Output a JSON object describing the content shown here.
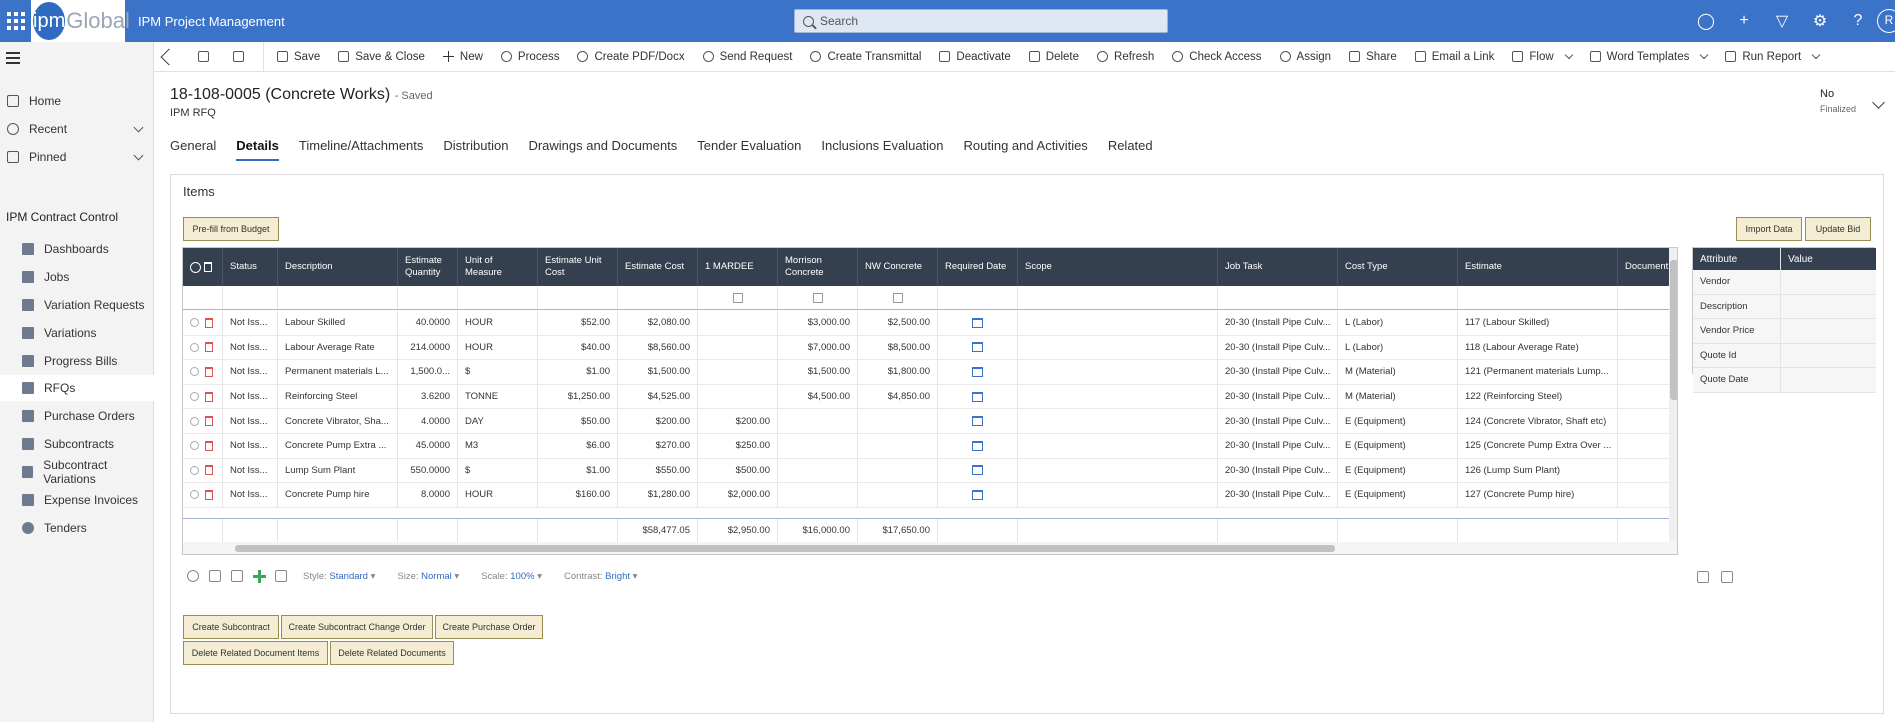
{
  "app": {
    "logo_mark": "ipm",
    "logo_text": "Global",
    "title": "IPM Project Management",
    "search_placeholder": "Search",
    "avatar_initial": "R"
  },
  "sidebar": {
    "home": "Home",
    "recent": "Recent",
    "pinned": "Pinned",
    "section": "IPM Contract Control",
    "items": [
      {
        "label": "Dashboards",
        "icon": "dashboard-icon"
      },
      {
        "label": "Jobs",
        "icon": "jobs-icon"
      },
      {
        "label": "Variation Requests",
        "icon": "document-icon"
      },
      {
        "label": "Variations",
        "icon": "document-icon"
      },
      {
        "label": "Progress Bills",
        "icon": "bill-icon"
      },
      {
        "label": "RFQs",
        "icon": "document-icon"
      },
      {
        "label": "Purchase Orders",
        "icon": "document-icon"
      },
      {
        "label": "Subcontracts",
        "icon": "document-icon"
      },
      {
        "label": "Subcontract Variations",
        "icon": "document-icon"
      },
      {
        "label": "Expense Invoices",
        "icon": "document-icon"
      },
      {
        "label": "Tenders",
        "icon": "tender-icon"
      }
    ]
  },
  "commands": {
    "save": "Save",
    "save_close": "Save & Close",
    "new": "New",
    "process": "Process",
    "create_pdf": "Create PDF/Docx",
    "send_request": "Send Request",
    "create_transmittal": "Create Transmittal",
    "deactivate": "Deactivate",
    "delete": "Delete",
    "refresh": "Refresh",
    "check_access": "Check Access",
    "assign": "Assign",
    "share": "Share",
    "email_link": "Email a Link",
    "flow": "Flow",
    "word_templates": "Word Templates",
    "run_report": "Run Report"
  },
  "record": {
    "title": "18-108-0005 (Concrete Works)",
    "saved": "- Saved",
    "entity": "IPM RFQ",
    "finalized_value": "No",
    "finalized_label": "Finalized"
  },
  "tabs": [
    "General",
    "Details",
    "Timeline/Attachments",
    "Distribution",
    "Drawings and Documents",
    "Tender Evaluation",
    "Inclusions Evaluation",
    "Routing and Activities",
    "Related"
  ],
  "items": {
    "title": "Items",
    "prefill_button": "Pre-fill from Budget",
    "import_button": "Import Data",
    "update_button": "Update Bid",
    "columns": [
      "Status",
      "Description",
      "Estimate Quantity",
      "Unit of Measure",
      "Estimate Unit Cost",
      "Estimate Cost",
      "1 MARDEE",
      "Morrison Concrete",
      "NW Concrete",
      "Required Date",
      "Scope",
      "Job Task",
      "Cost Type",
      "Estimate",
      "Document"
    ],
    "rows": [
      {
        "status": "Not Iss...",
        "description": "Labour Skilled",
        "qty": "40.0000",
        "uom": "HOUR",
        "unit_cost": "$52.00",
        "est_cost": "$2,080.00",
        "mardee": "",
        "morrison": "$3,000.00",
        "nw": "$2,500.00",
        "job_task": "20-30 (Install Pipe Culv...",
        "cost_type": "L (Labor)",
        "estimate": "117 (Labour Skilled)"
      },
      {
        "status": "Not Iss...",
        "description": "Labour Average Rate",
        "qty": "214.0000",
        "uom": "HOUR",
        "unit_cost": "$40.00",
        "est_cost": "$8,560.00",
        "mardee": "",
        "morrison": "$7,000.00",
        "nw": "$8,500.00",
        "job_task": "20-30 (Install Pipe Culv...",
        "cost_type": "L (Labor)",
        "estimate": "118 (Labour Average Rate)"
      },
      {
        "status": "Not Iss...",
        "description": "Permanent materials L...",
        "qty": "1,500.0...",
        "uom": "$",
        "unit_cost": "$1.00",
        "est_cost": "$1,500.00",
        "mardee": "",
        "morrison": "$1,500.00",
        "nw": "$1,800.00",
        "job_task": "20-30 (Install Pipe Culv...",
        "cost_type": "M (Material)",
        "estimate": "121 (Permanent materials Lump..."
      },
      {
        "status": "Not Iss...",
        "description": "Reinforcing Steel",
        "qty": "3.6200",
        "uom": "TONNE",
        "unit_cost": "$1,250.00",
        "est_cost": "$4,525.00",
        "mardee": "",
        "morrison": "$4,500.00",
        "nw": "$4,850.00",
        "job_task": "20-30 (Install Pipe Culv...",
        "cost_type": "M (Material)",
        "estimate": "122 (Reinforcing Steel)"
      },
      {
        "status": "Not Iss...",
        "description": "Concrete Vibrator, Sha...",
        "qty": "4.0000",
        "uom": "DAY",
        "unit_cost": "$50.00",
        "est_cost": "$200.00",
        "mardee": "$200.00",
        "morrison": "",
        "nw": "",
        "job_task": "20-30 (Install Pipe Culv...",
        "cost_type": "E (Equipment)",
        "estimate": "124 (Concrete Vibrator, Shaft etc)"
      },
      {
        "status": "Not Iss...",
        "description": "Concrete Pump Extra ...",
        "qty": "45.0000",
        "uom": "M3",
        "unit_cost": "$6.00",
        "est_cost": "$270.00",
        "mardee": "$250.00",
        "morrison": "",
        "nw": "",
        "job_task": "20-30 (Install Pipe Culv...",
        "cost_type": "E (Equipment)",
        "estimate": "125 (Concrete Pump Extra Over ..."
      },
      {
        "status": "Not Iss...",
        "description": "Lump Sum Plant",
        "qty": "550.0000",
        "uom": "$",
        "unit_cost": "$1.00",
        "est_cost": "$550.00",
        "mardee": "$500.00",
        "morrison": "",
        "nw": "",
        "job_task": "20-30 (Install Pipe Culv...",
        "cost_type": "E (Equipment)",
        "estimate": "126 (Lump Sum Plant)"
      },
      {
        "status": "Not Iss...",
        "description": "Concrete Pump hire",
        "qty": "8.0000",
        "uom": "HOUR",
        "unit_cost": "$160.00",
        "est_cost": "$1,280.00",
        "mardee": "$2,000.00",
        "morrison": "",
        "nw": "",
        "job_task": "20-30 (Install Pipe Culv...",
        "cost_type": "E (Equipment)",
        "estimate": "127 (Concrete Pump hire)"
      }
    ],
    "totals": {
      "est_cost": "$58,477.05",
      "mardee": "$2,950.00",
      "morrison": "$16,000.00",
      "nw": "$17,650.00"
    }
  },
  "attributes": {
    "col_attr": "Attribute",
    "col_value": "Value",
    "rows": [
      "Vendor",
      "Description",
      "Vendor Price",
      "Quote Id",
      "Quote Date"
    ]
  },
  "grid_toolbar": {
    "style_label": "Style:",
    "style_value": "Standard",
    "size_label": "Size:",
    "size_value": "Normal",
    "scale_label": "Scale:",
    "scale_value": "100%",
    "contrast_label": "Contrast:",
    "contrast_value": "Bright"
  },
  "actions": {
    "create_subcontract": "Create Subcontract",
    "create_change_order": "Create Subcontract Change Order",
    "create_po": "Create Purchase Order",
    "delete_related_items": "Delete Related Document Items",
    "delete_related_docs": "Delete Related Documents"
  }
}
